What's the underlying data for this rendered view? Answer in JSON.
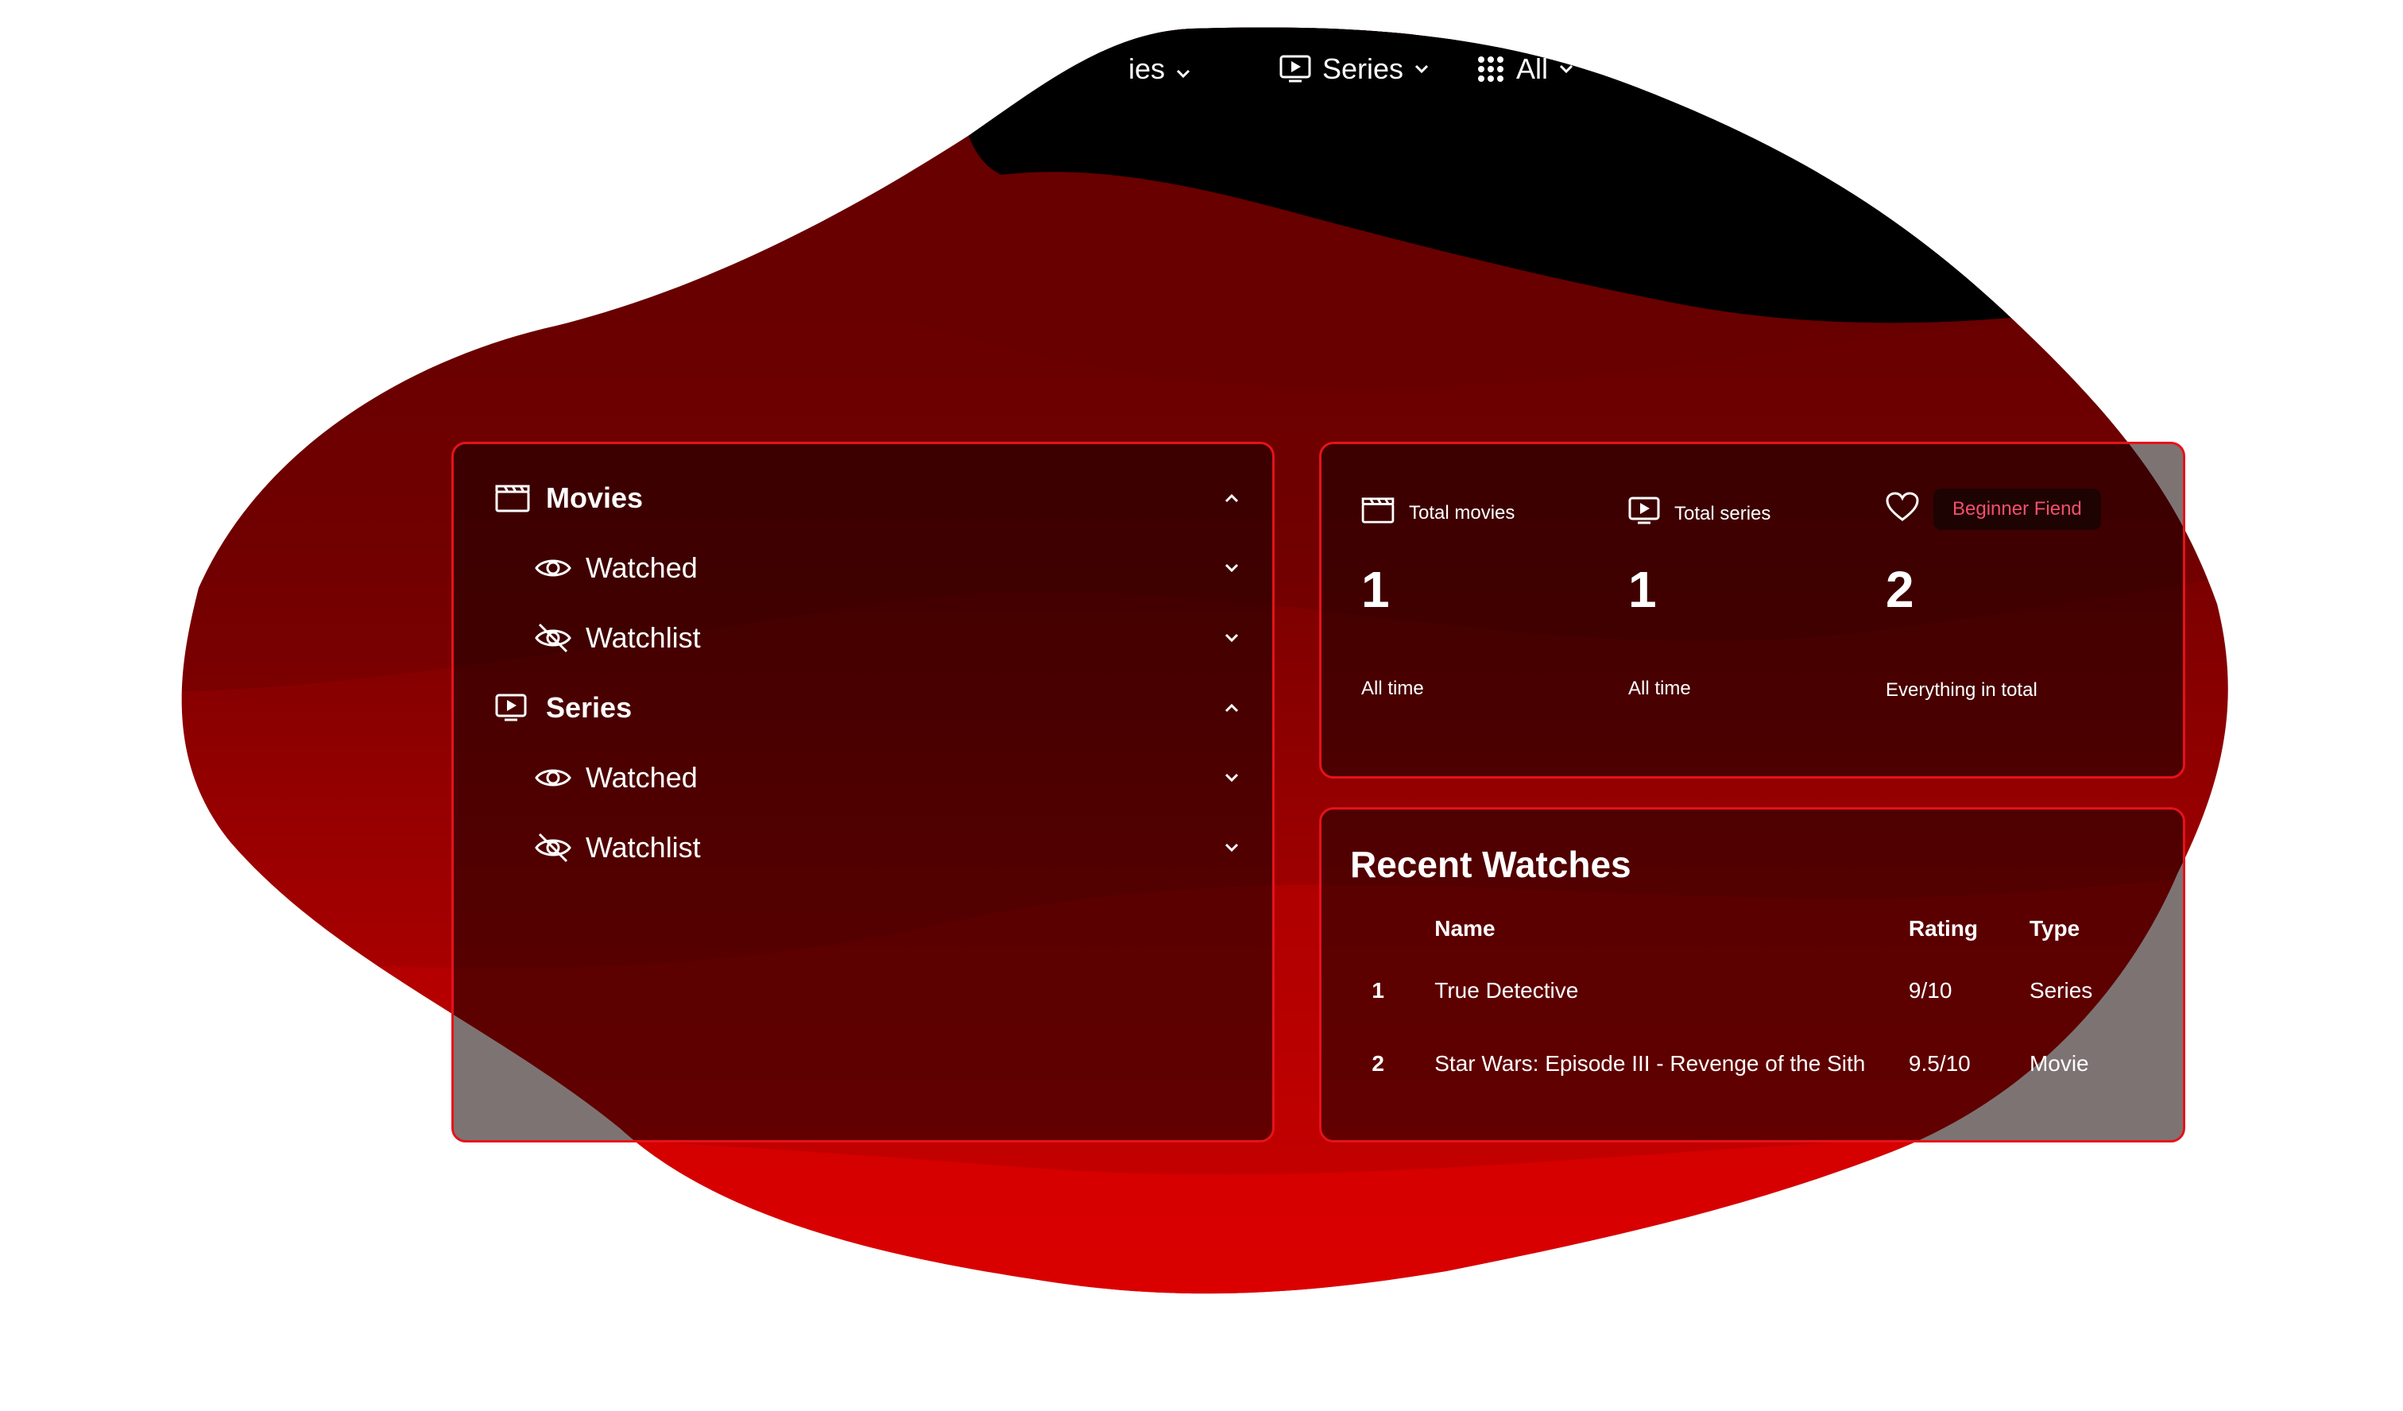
{
  "nav": {
    "movies_label_partial": "ies",
    "series_label": "Series",
    "all_label": "All"
  },
  "sidebar": {
    "sections": [
      {
        "label": "Movies",
        "icon": "clapperboard-icon",
        "items": [
          {
            "label": "Watched",
            "icon": "eye-icon"
          },
          {
            "label": "Watchlist",
            "icon": "eye-off-icon"
          }
        ]
      },
      {
        "label": "Series",
        "icon": "tv-play-icon",
        "items": [
          {
            "label": "Watched",
            "icon": "eye-icon"
          },
          {
            "label": "Watchlist",
            "icon": "eye-off-icon"
          }
        ]
      }
    ]
  },
  "stats": [
    {
      "label": "Total movies",
      "icon": "clapperboard-icon",
      "value": "1",
      "sub": "All time"
    },
    {
      "label": "Total series",
      "icon": "tv-play-icon",
      "value": "1",
      "sub": "All time"
    },
    {
      "label": "",
      "icon": "heart-icon",
      "badge": "Beginner Fiend",
      "value": "2",
      "sub": "Everything in total"
    }
  ],
  "recent": {
    "title": "Recent Watches",
    "columns": [
      "",
      "Name",
      "Rating",
      "Type"
    ],
    "rows": [
      {
        "idx": "1",
        "name": "True Detective",
        "rating": "9/10",
        "type": "Series"
      },
      {
        "idx": "2",
        "name": "Star Wars: Episode III - Revenge of the Sith",
        "rating": "9.5/10",
        "type": "Movie"
      }
    ]
  },
  "colors": {
    "accent": "#e6121a",
    "badge_text": "#f2506a",
    "blob_dark": "#000000",
    "blob_red": "#e00000"
  }
}
